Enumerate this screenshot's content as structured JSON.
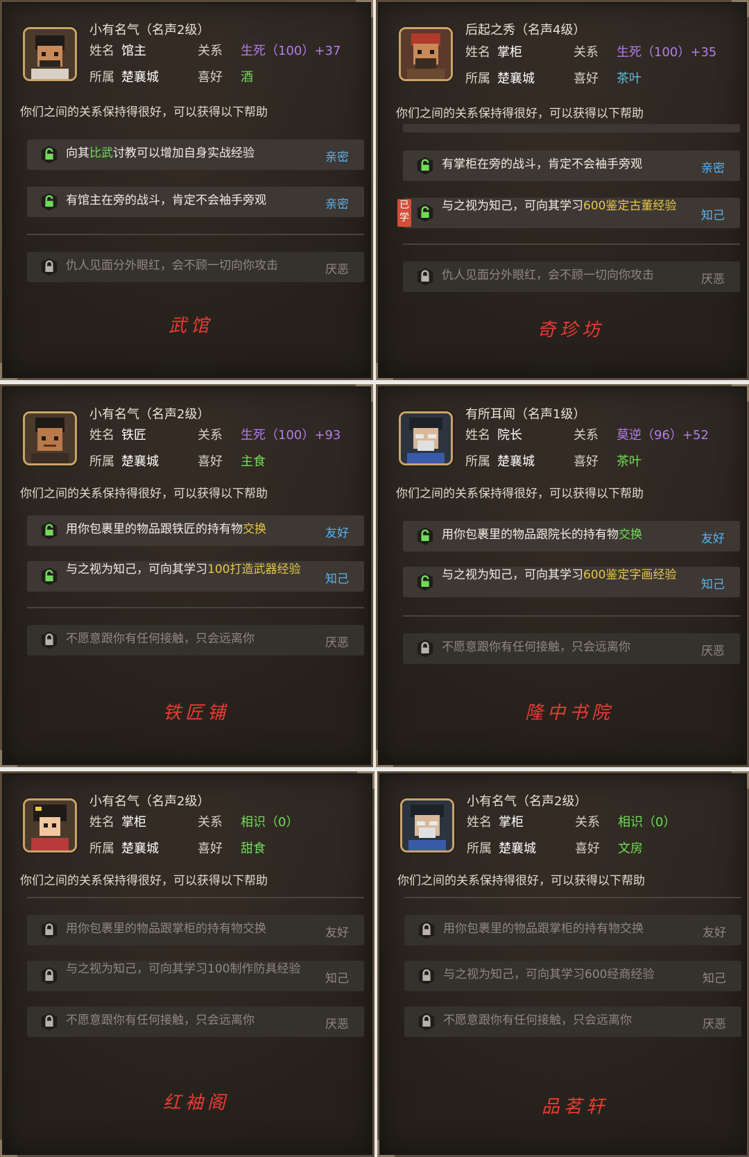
{
  "common": {
    "name_label": "姓名",
    "belong_label": "所属",
    "relation_label": "关系",
    "like_label": "喜好",
    "subtitle": "你们之间的关系保持得很好，可以获得以下帮助"
  },
  "colors": {
    "green_hl": "#6fdc58",
    "gold_hl": "#e5c64a",
    "purple": "#b27cf0",
    "teal": "#58c0d8",
    "tag_blue": "#5ab2f2",
    "place_red": "#ea3b34"
  },
  "panels": [
    {
      "fame": "小有名气（名声2级）",
      "name": "馆主",
      "belong": "楚襄城",
      "relation": "生死（100）+37",
      "like": "酒",
      "place": "武馆",
      "rows": [
        {
          "pre": "向其",
          "hl": "比武",
          "post": "讨教可以增加自身实战经验",
          "tag": "亲密"
        },
        {
          "text": "有馆主在旁的战斗，肯定不会袖手旁观",
          "tag": "亲密"
        },
        {
          "text": "仇人见面分外眼红，会不顾一切向你攻击",
          "tag": "厌恶"
        }
      ]
    },
    {
      "fame": "后起之秀（名声4级）",
      "name": "掌柜",
      "belong": "楚襄城",
      "relation": "生死（100）+35",
      "like": "茶叶",
      "place": "奇珍坊",
      "learned": "已学",
      "rows": [
        {
          "text": "有掌柜在旁的战斗，肯定不会袖手旁观",
          "tag": "亲密"
        },
        {
          "pre": "与之视为知己，可向其学习",
          "hl": "600鉴定古董经验",
          "tag": "知己"
        },
        {
          "text": "仇人见面分外眼红，会不顾一切向你攻击",
          "tag": "厌恶"
        }
      ]
    },
    {
      "fame": "小有名气（名声2级）",
      "name": "铁匠",
      "belong": "楚襄城",
      "relation": "生死（100）+93",
      "like": "主食",
      "place": "铁匠铺",
      "rows": [
        {
          "pre": "用你包裹里的物品跟铁匠的持有物",
          "hl": "交换",
          "tag": "友好"
        },
        {
          "pre": "与之视为知己，可向其学习",
          "hl": "100打造武器经验",
          "tag": "知己"
        },
        {
          "text": "不愿意跟你有任何接触，只会远离你",
          "tag": "厌恶"
        }
      ]
    },
    {
      "fame": "有所耳闻（名声1级）",
      "name": "院长",
      "belong": "楚襄城",
      "relation": "莫逆（96）+52",
      "like": "茶叶",
      "place": "隆中书院",
      "rows": [
        {
          "pre": "用你包裹里的物品跟院长的持有物",
          "hl": "交换",
          "tag": "友好"
        },
        {
          "pre": "与之视为知己，可向其学习",
          "hl": "600鉴定字画经验",
          "tag": "知己"
        },
        {
          "text": "不愿意跟你有任何接触，只会远离你",
          "tag": "厌恶"
        }
      ]
    },
    {
      "fame": "小有名气（名声2级）",
      "name": "掌柜",
      "belong": "楚襄城",
      "relation": "相识（0）",
      "like": "甜食",
      "place": "红袖阁",
      "rows": [
        {
          "text": "用你包裹里的物品跟掌柜的持有物交换",
          "tag": "友好"
        },
        {
          "text": "与之视为知己，可向其学习100制作防具经验",
          "tag": "知己"
        },
        {
          "text": "不愿意跟你有任何接触，只会远离你",
          "tag": "厌恶"
        }
      ]
    },
    {
      "fame": "小有名气（名声2级）",
      "name": "掌柜",
      "belong": "楚襄城",
      "relation": "相识（0）",
      "like": "文房",
      "place": "品茗轩",
      "rows": [
        {
          "text": "用你包裹里的物品跟掌柜的持有物交换",
          "tag": "友好"
        },
        {
          "text": "与之视为知己，可向其学习600经商经验",
          "tag": "知己"
        },
        {
          "text": "不愿意跟你有任何接触，只会远离你",
          "tag": "厌恶"
        }
      ]
    }
  ]
}
